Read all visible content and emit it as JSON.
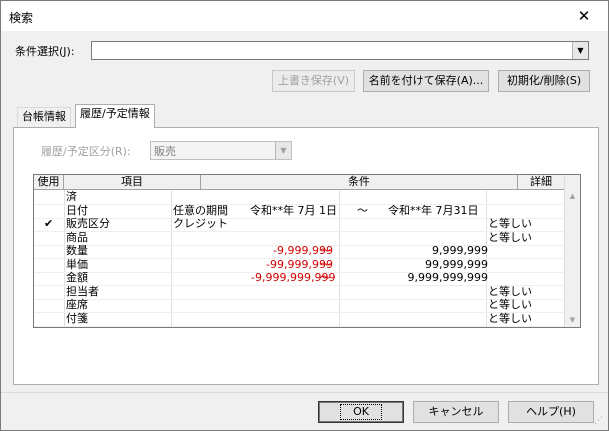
{
  "window": {
    "title": "検索",
    "close_glyph": "✕"
  },
  "condition": {
    "label": "条件選択(J):",
    "value": ""
  },
  "top_buttons": {
    "overwrite": "上書き保存(V)",
    "save_as": "名前を付けて保存(A)...",
    "reset": "初期化/削除(S)"
  },
  "tabs": [
    {
      "label": "台帳情報"
    },
    {
      "label": "履歴/予定情報"
    }
  ],
  "history": {
    "label": "履歴/予定区分(R):",
    "value": "販売"
  },
  "grid": {
    "headers": {
      "use": "使用",
      "item": "項目",
      "condition": "条件",
      "detail": "詳細"
    },
    "rows": [
      {
        "check": "",
        "item": "済",
        "c1": "",
        "c2": "",
        "c3": "",
        "c4": "",
        "detail": ""
      },
      {
        "check": "",
        "item": "日付",
        "c1": "任意の期間",
        "c2": "令和**年 7月 1日",
        "c3": "〜",
        "c4": "令和**年 7月31日",
        "detail": ""
      },
      {
        "check": "✔",
        "item": "販売区分",
        "c1": "クレジット",
        "c2": "",
        "c3": "",
        "c4": "",
        "detail": "と等しい"
      },
      {
        "check": "",
        "item": "商品",
        "c1": "",
        "c2": "",
        "c3": "",
        "c4": "",
        "detail": "と等しい"
      },
      {
        "check": "",
        "item": "数量",
        "c1": "",
        "c2": "-9,999,999",
        "c3": "〜",
        "c4": "9,999,999",
        "detail": ""
      },
      {
        "check": "",
        "item": "単価",
        "c1": "",
        "c2": "-99,999,999",
        "c3": "〜",
        "c4": "99,999,999",
        "detail": ""
      },
      {
        "check": "",
        "item": "金額",
        "c1": "",
        "c2": "-9,999,999,999",
        "c3": "〜",
        "c4": "9,999,999,999",
        "detail": ""
      },
      {
        "check": "",
        "item": "担当者",
        "c1": "",
        "c2": "",
        "c3": "",
        "c4": "",
        "detail": "と等しい"
      },
      {
        "check": "",
        "item": "座席",
        "c1": "",
        "c2": "",
        "c3": "",
        "c4": "",
        "detail": "と等しい"
      },
      {
        "check": "",
        "item": "付箋",
        "c1": "",
        "c2": "",
        "c3": "",
        "c4": "",
        "detail": "と等しい"
      }
    ]
  },
  "bottom_buttons": {
    "ok": "OK",
    "cancel": "キャンセル",
    "help": "ヘルプ(H)"
  },
  "colors": {
    "negative": "#d40000"
  }
}
